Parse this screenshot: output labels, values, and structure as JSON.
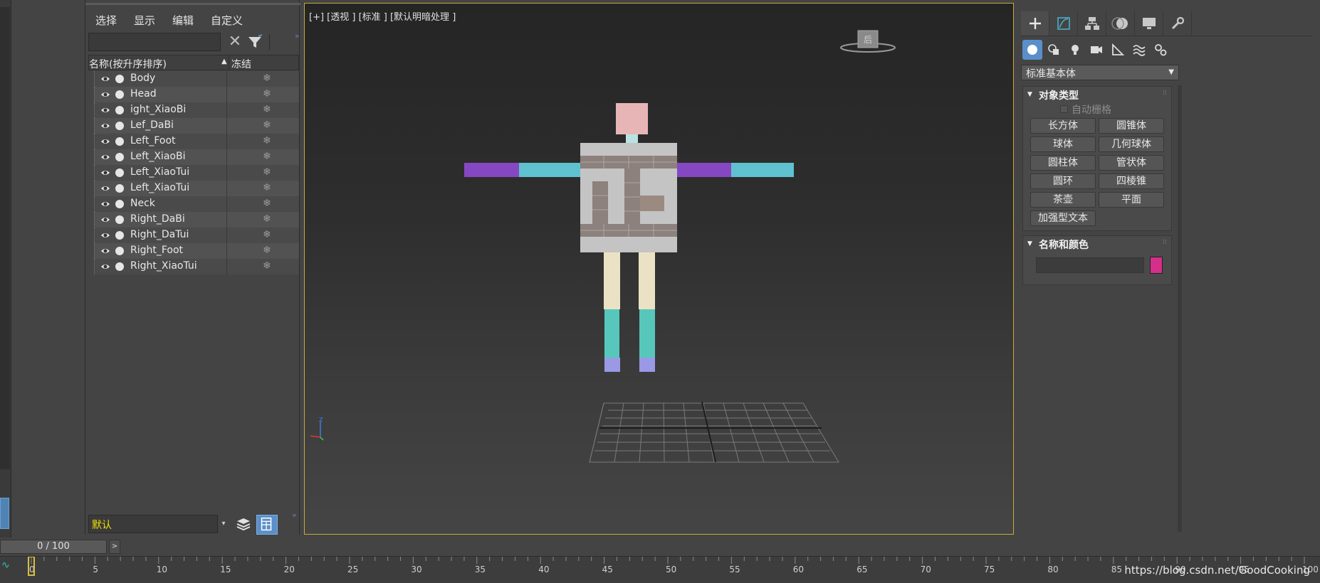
{
  "explorer": {
    "menu": [
      "选择",
      "显示",
      "编辑",
      "自定义"
    ],
    "search_value": "",
    "col_name": "名称(按升序排序)",
    "col_freeze": "冻结",
    "objects": [
      "Body",
      "Head",
      "ight_XiaoBi",
      "Lef_DaBi",
      "Left_Foot",
      "Left_XiaoBi",
      "Left_XiaoTui",
      "Left_XiaoTui",
      "Neck",
      "Right_DaBi",
      "Right_DaTui",
      "Right_Foot",
      "Right_XiaoTui"
    ],
    "layer_value": "默认"
  },
  "viewport": {
    "label": "[+] [透视 ] [标准 ] [默认明暗处理 ]",
    "viewcube_face": "后",
    "axis_label": "z"
  },
  "command_panel": {
    "category": "标准基本体",
    "rollout_object_type": "对象类型",
    "autogrid": "自动栅格",
    "buttons": [
      "长方体",
      "圆锥体",
      "球体",
      "几何球体",
      "圆柱体",
      "管状体",
      "圆环",
      "四棱锥",
      "茶壶",
      "平面",
      "加强型文本"
    ],
    "rollout_name_color": "名称和颜色",
    "name_value": "",
    "swatch_color": "#d52f8a"
  },
  "timeline": {
    "slider_text": "0 / 100",
    "current_frame": 0,
    "total_frames": 100,
    "tick_labels": [
      "0",
      "5",
      "10",
      "15",
      "20",
      "25",
      "30",
      "35",
      "40",
      "45",
      "50",
      "55",
      "60",
      "65",
      "70",
      "75",
      "80",
      "85",
      "90",
      "95",
      "100"
    ]
  },
  "watermark": "https://blog.csdn.net/GoodCooking"
}
